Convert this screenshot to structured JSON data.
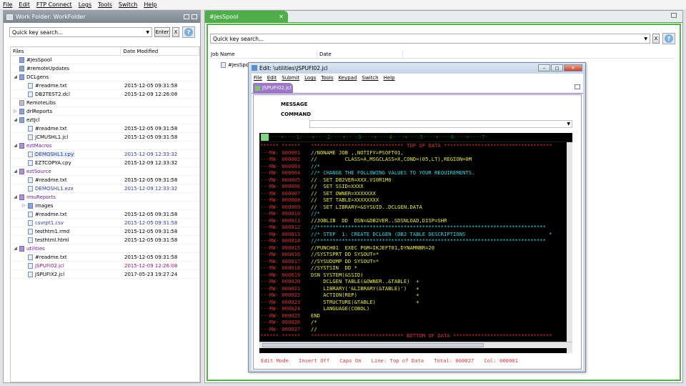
{
  "menu": [
    "File",
    "Edit",
    "FTP Connect",
    "Logs",
    "Tools",
    "Switch",
    "Help"
  ],
  "left": {
    "title": "Work Folder: WorkFolder",
    "search_placeholder": "Quick key search...",
    "enter_label": "Enter",
    "clear_label": "X",
    "col_files": "Files",
    "col_date": "Date Modified",
    "rows": [
      {
        "indent": 0,
        "twisty": "",
        "icon": "folder",
        "name": "#JesSpool",
        "date": "",
        "color": ""
      },
      {
        "indent": 0,
        "twisty": "",
        "icon": "folder",
        "name": "#remoteUpdates",
        "date": "",
        "color": ""
      },
      {
        "indent": 0,
        "twisty": "◢",
        "icon": "folder",
        "name": "DCLgens",
        "date": "",
        "color": ""
      },
      {
        "indent": 1,
        "twisty": "",
        "icon": "file",
        "name": "#readme.txt",
        "date": "2015-12-05 09:31:58",
        "color": ""
      },
      {
        "indent": 1,
        "twisty": "",
        "icon": "file",
        "name": "DB2TEST2.dcl",
        "date": "2015-12-09 12:26:08",
        "color": ""
      },
      {
        "indent": 0,
        "twisty": "",
        "icon": "folder gray",
        "name": "RemoteLibs",
        "date": "",
        "color": ""
      },
      {
        "indent": 0,
        "twisty": "▷",
        "icon": "folder",
        "name": "drlReports",
        "date": "",
        "color": ""
      },
      {
        "indent": 0,
        "twisty": "◢",
        "icon": "folder",
        "name": "eztJcl",
        "date": "",
        "color": ""
      },
      {
        "indent": 1,
        "twisty": "",
        "icon": "file",
        "name": "#readme.txt",
        "date": "2015-12-05 09:31:58",
        "color": ""
      },
      {
        "indent": 1,
        "twisty": "",
        "icon": "file",
        "name": "JCMUSHL1.jcl",
        "date": "2015-12-05 09:31:58",
        "color": ""
      },
      {
        "indent": 0,
        "twisty": "◢",
        "icon": "folder purple",
        "name": "eztMacros",
        "date": "",
        "color": "purple"
      },
      {
        "indent": 1,
        "twisty": "",
        "icon": "file",
        "name": "DEMOSHL1.cpy",
        "date": "2015-12-09 12:33:32",
        "color": "blue",
        "selected": true
      },
      {
        "indent": 1,
        "twisty": "",
        "icon": "file",
        "name": "EZTCOPYA.cpy",
        "date": "2015-12-09 12:33:32",
        "color": ""
      },
      {
        "indent": 0,
        "twisty": "◢",
        "icon": "folder purple",
        "name": "eztSource",
        "date": "",
        "color": "purple"
      },
      {
        "indent": 1,
        "twisty": "",
        "icon": "file",
        "name": "#readme.txt",
        "date": "2015-12-05 09:31:58",
        "color": ""
      },
      {
        "indent": 1,
        "twisty": "",
        "icon": "file",
        "name": "DEMOSHL1.ezx",
        "date": "2015-12-09 12:33:32",
        "color": "blue"
      },
      {
        "indent": 0,
        "twisty": "◢",
        "icon": "folder purple",
        "name": "rmuReports",
        "date": "",
        "color": "purple"
      },
      {
        "indent": 1,
        "twisty": "▷",
        "icon": "folder",
        "name": "images",
        "date": "",
        "color": ""
      },
      {
        "indent": 1,
        "twisty": "",
        "icon": "file",
        "name": "#readme.txt",
        "date": "2015-12-05 09:31:58",
        "color": ""
      },
      {
        "indent": 1,
        "twisty": "",
        "icon": "file",
        "name": "csvrpt1.csv",
        "date": "2015-12-05 09:31:58",
        "color": "blue"
      },
      {
        "indent": 1,
        "twisty": "",
        "icon": "file",
        "name": "testhtm1.rmd",
        "date": "2015-12-05 09:31:58",
        "color": ""
      },
      {
        "indent": 1,
        "twisty": "",
        "icon": "file",
        "name": "testhtml.html",
        "date": "2015-12-05 09:31:58",
        "color": ""
      },
      {
        "indent": 0,
        "twisty": "◢",
        "icon": "folder purple",
        "name": "utilities",
        "date": "",
        "color": "purple"
      },
      {
        "indent": 1,
        "twisty": "",
        "icon": "file",
        "name": "#readme.txt",
        "date": "2015-12-05 09:31:58",
        "color": ""
      },
      {
        "indent": 1,
        "twisty": "",
        "icon": "file",
        "name": "JSPUFI02.jcl",
        "date": "2015-12-09 12:26:08",
        "color": "pink"
      },
      {
        "indent": 1,
        "twisty": "",
        "icon": "file",
        "name": "JSPUFIX2.jcl",
        "date": "2017-05-23 19:27:24",
        "color": ""
      }
    ]
  },
  "right": {
    "tab_label": "#JesSpool",
    "tab_close": "✕",
    "search_placeholder": "Quick key search...",
    "clear_label": "X",
    "col_job": "Job Name",
    "col_date": "Date",
    "job_row": "#JesSpool"
  },
  "editor": {
    "title": "Edit: \\utilities\\JSPUFI02.jcl",
    "menu": [
      "File",
      "Edit",
      "Submit",
      "Logs",
      "Tools",
      "Keypad",
      "Switch",
      "Help"
    ],
    "tab_label": "JSPUFI02.jcl",
    "message_label": "MESSAGE",
    "command_label": "COMMAND",
    "ruler": "----+----1----+----2----+----3----+----4----+----5----+----6----+----7-",
    "lines": [
      {
        "prefix": "****** ******",
        "text": "****************************** TOP OF DATA ***********************************",
        "kind": "data"
      },
      {
        "prefix": "---RW- 000001",
        "text": "//NONAME JOB ,,NOTIFY=PSOFT01,",
        "kind": ""
      },
      {
        "prefix": "---RW- 000002",
        "text": "//         CLASS=A,MSGCLASS=X,COND=(05,LT),REGION=0M",
        "kind": ""
      },
      {
        "prefix": "---RW- 000003",
        "text": "//*",
        "kind": "cyan"
      },
      {
        "prefix": "---RW- 000004",
        "text": "//* CHANGE THE FOLLOWING VALUES TO YOUR REQUIREMENTS.",
        "kind": "cyan"
      },
      {
        "prefix": "---RW- 000005",
        "text": "//  SET DB2VER=XXX.V10R1M0",
        "kind": ""
      },
      {
        "prefix": "---RW- 000006",
        "text": "//  SET SSID=XXXX",
        "kind": ""
      },
      {
        "prefix": "---RW- 000007",
        "text": "//  SET OWNER=XXXXXXX",
        "kind": ""
      },
      {
        "prefix": "---RW- 000008",
        "text": "//  SET TABLE=XXXXXXXX",
        "kind": ""
      },
      {
        "prefix": "---RW- 000009",
        "text": "//  SET LIBRARY=&SYSUID..DCLGEN.DATA",
        "kind": ""
      },
      {
        "prefix": "---RW- 000010",
        "text": "//*",
        "kind": "cyan"
      },
      {
        "prefix": "---RW- 000011",
        "text": "//JOBLIB  DD  DSN=&DB2VER..SDSNLOAD,DISP=SHR",
        "kind": ""
      },
      {
        "prefix": "---RW- 000012",
        "text": "//**************************************************************************",
        "kind": "cyan"
      },
      {
        "prefix": "---RW- 000013",
        "text": "//* STEP  1: CREATE DCLGEN (DB2 TABLE DESCRIPTIONS                           *",
        "kind": "cyan"
      },
      {
        "prefix": "---RW- 000014",
        "text": "//**************************************************************************",
        "kind": "cyan"
      },
      {
        "prefix": "---RW- 000015",
        "text": "//PUNCH01  EXEC PGM=IKJEFT01,DYNAMNBR=20",
        "kind": ""
      },
      {
        "prefix": "---RW- 000016",
        "text": "//SYSTSPRT DD SYSOUT=*",
        "kind": ""
      },
      {
        "prefix": "---RW- 000017",
        "text": "//SYSUDUMP DD SYSOUT=*",
        "kind": ""
      },
      {
        "prefix": "---RW- 000018",
        "text": "//SYSTSIN  DD *",
        "kind": ""
      },
      {
        "prefix": "---RW- 000019",
        "text": "DSN SYSTEM(&SSID)",
        "kind": ""
      },
      {
        "prefix": "---RW- 000020",
        "text": "    DCLGEN TABLE(&OWNER..&TABLE)  +",
        "kind": ""
      },
      {
        "prefix": "---RW- 000021",
        "text": "    LIBRARY('&LIBRARY(&TABLE)')   +",
        "kind": ""
      },
      {
        "prefix": "---RW- 000022",
        "text": "    ACTION(REP)                   +",
        "kind": ""
      },
      {
        "prefix": "---RW- 000023",
        "text": "    STRUCTURE(&TABLE)             +",
        "kind": ""
      },
      {
        "prefix": "---RW- 000024",
        "text": "    LANGUAGE(COBOL)",
        "kind": ""
      },
      {
        "prefix": "---RW- 000025",
        "text": "END",
        "kind": ""
      },
      {
        "prefix": "---RW- 000026",
        "text": "/*",
        "kind": ""
      },
      {
        "prefix": "---RW- 000027",
        "text": "//",
        "kind": ""
      },
      {
        "prefix": "****** ******",
        "text": "****************************** BOTTOM OF DATA ********************************",
        "kind": "data"
      }
    ],
    "status": {
      "mode": "Edit Mode",
      "insert": "Insert Off",
      "caps": "Caps On",
      "line": "Line: Top of Data",
      "total": "Total: 000027",
      "col": "Col: 000001"
    }
  }
}
